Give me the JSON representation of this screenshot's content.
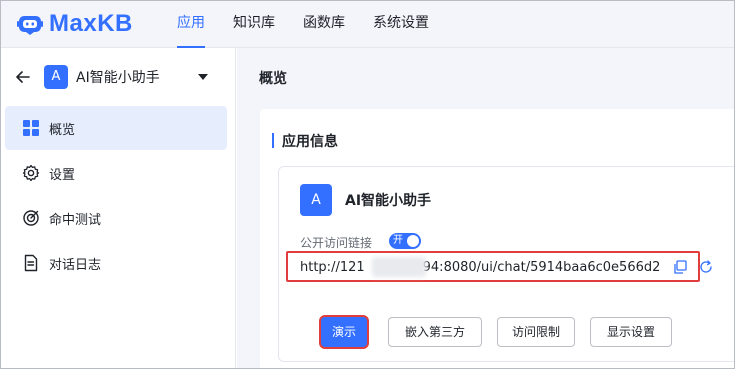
{
  "brand": {
    "name": "MaxKB"
  },
  "topnav": {
    "items": [
      {
        "label": "应用",
        "active": true
      },
      {
        "label": "知识库",
        "active": false
      },
      {
        "label": "函数库",
        "active": false
      },
      {
        "label": "系统设置",
        "active": false
      }
    ]
  },
  "sidebar": {
    "app_badge": "A",
    "app_name": "AI智能小助手",
    "items": [
      {
        "label": "概览",
        "icon": "grid-icon",
        "active": true
      },
      {
        "label": "设置",
        "icon": "gear-icon",
        "active": false
      },
      {
        "label": "命中测试",
        "icon": "target-icon",
        "active": false
      },
      {
        "label": "对话日志",
        "icon": "document-icon",
        "active": false
      }
    ]
  },
  "main": {
    "title": "概览",
    "section_title": "应用信息",
    "app_badge": "A",
    "app_name": "AI智能小助手",
    "public_link_label": "公开访问链接",
    "toggle_label": "开",
    "url_prefix": "http://121",
    "url_suffix": "94:8080/ui/chat/5914baa6c0e566d2",
    "buttons": {
      "demo": "演示",
      "embed": "嵌入第三方",
      "access": "访问限制",
      "display": "显示设置"
    }
  },
  "colors": {
    "accent": "#3370ff",
    "highlight_border": "#e23d3d",
    "main_bg": "#f3f5fb"
  }
}
